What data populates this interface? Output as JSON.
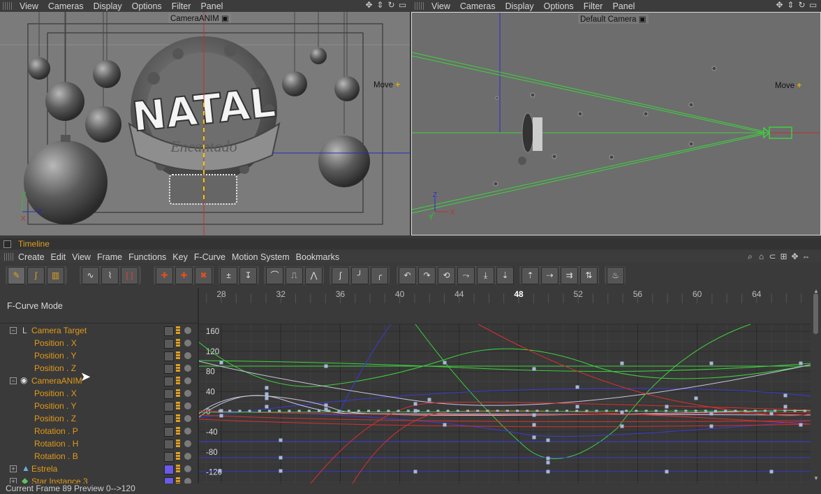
{
  "left_viewport": {
    "menu": [
      "View",
      "Cameras",
      "Display",
      "Options",
      "Filter",
      "Panel"
    ],
    "camera_label": "CameraANIM",
    "move_label": "Move",
    "title_text": "NATAL",
    "subtitle_text": "Encantado",
    "axis_y": "Y",
    "axis_z": "Z",
    "axis_x": "X"
  },
  "right_viewport": {
    "menu": [
      "View",
      "Cameras",
      "Display",
      "Options",
      "Filter",
      "Panel"
    ],
    "camera_label": "Default Camera",
    "move_label": "Move",
    "axis_z": "Z",
    "axis_y": "Y",
    "axis_x": "X"
  },
  "timeline": {
    "title": "Timeline",
    "menu": [
      "Create",
      "Edit",
      "View",
      "Frame",
      "Functions",
      "Key",
      "F-Curve",
      "Motion System",
      "Bookmarks"
    ],
    "mode_label": "F-Curve Mode",
    "frame_ticks": [
      "28",
      "32",
      "36",
      "40",
      "44",
      "48",
      "52",
      "56",
      "60",
      "64"
    ],
    "value_ticks": [
      "160",
      "120",
      "80",
      "40",
      "0",
      "-40",
      "-80",
      "-120"
    ],
    "tree": [
      {
        "label": "Camera Target",
        "indent": 0,
        "expander": "−"
      },
      {
        "label": "Position . X",
        "indent": 1
      },
      {
        "label": "Position . Y",
        "indent": 1
      },
      {
        "label": "Position . Z",
        "indent": 1
      },
      {
        "label": "CameraANIM",
        "indent": 0,
        "expander": "−"
      },
      {
        "label": "Position . X",
        "indent": 1
      },
      {
        "label": "Position . Y",
        "indent": 1
      },
      {
        "label": "Position . Z",
        "indent": 1
      },
      {
        "label": "Rotation . P",
        "indent": 1
      },
      {
        "label": "Rotation . H",
        "indent": 1
      },
      {
        "label": "Rotation . B",
        "indent": 1
      },
      {
        "label": "Estrela",
        "indent": 0,
        "expander": "+"
      },
      {
        "label": "Star Instance 3",
        "indent": 0,
        "expander": "+"
      }
    ]
  },
  "status": {
    "text": "Current Frame  89  Preview  0-->120"
  },
  "colors": {
    "accent_orange": "#e39a18",
    "viewport_bg": "#7a7a7a",
    "curve_green": "#3ed23e",
    "curve_blue": "#3a3ad8",
    "curve_red": "#d83030",
    "curve_white": "#c8c8e0"
  }
}
